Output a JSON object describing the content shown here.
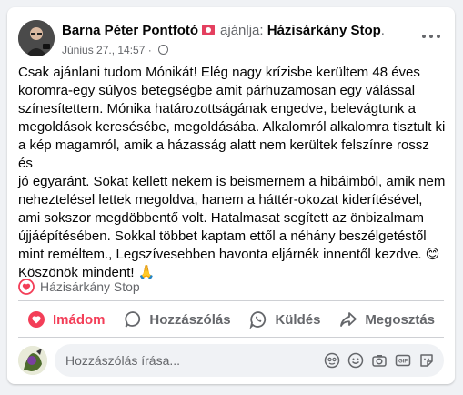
{
  "post": {
    "author": "Barna Péter Pontfotó",
    "verb": "ajánlja:",
    "target": "Házisárkány Stop",
    "target_suffix": ".",
    "date": "Június 27.",
    "time": "14:57",
    "meta_separator": "·",
    "body": "Csak ajánlani tudom Mónikát! Elég nagy krízisbe kerültem 48 éves\nkoromra-egy súlyos betegségbe amit párhuzamosan egy válással\nszínesítettem. Mónika határozottságának engedve, belevágtunk a\nmegoldások keresésébe, megoldásába. Alkalomról alkalomra tisztult ki\na kép magamról, amik a házasság alatt nem kerültek felszínre rossz és\njó egyaránt. Sokat kellett nekem is beismernem a hibáimból, amik nem\nneheztelésel lettek megoldva, hanem a háttér-okozat kiderítésével,\nami sokszor megdöbbentő volt. Hatalmasat segített az önbizalmam\nújjáépítésében. Sokkal többet kaptam ettől a néhány beszélgetéstől\nmint reméltem., Legszívesebben havonta eljárnék innentől kezdve. 😊\n Köszönök mindent! 🙏",
    "page_tag": "Házisárkány Stop"
  },
  "actions": {
    "like": "Imádom",
    "comment": "Hozzászólás",
    "send": "Küldés",
    "share": "Megosztás"
  },
  "comment_box": {
    "placeholder": "Hozzászólás írása..."
  },
  "colors": {
    "love": "#f33e58",
    "muted": "#65676b",
    "background": "#f0f2f5"
  },
  "icons": [
    "more-options-icon",
    "globe-icon",
    "recommend-badge-icon",
    "heart-icon",
    "comment-icon",
    "whatsapp-icon",
    "share-icon",
    "avatar-icon",
    "emoji-icon",
    "camera-icon",
    "gif-icon",
    "sticker-icon"
  ]
}
